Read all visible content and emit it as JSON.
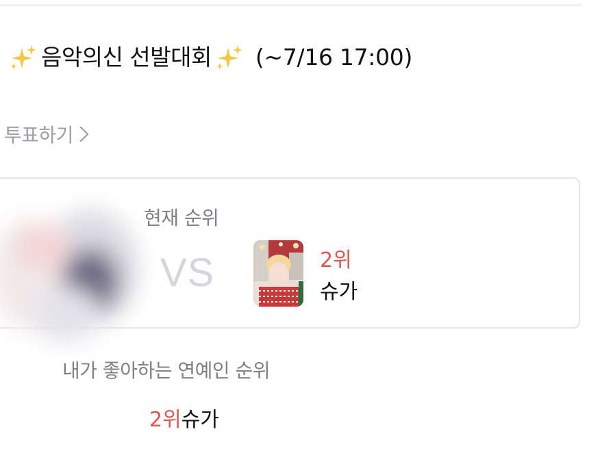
{
  "contest": {
    "title": "음악의신 선발대회",
    "deadline": "(~7/16 17:00)",
    "title_icon": "sparkles-icon",
    "accent_color": "#e0544f"
  },
  "vote_link": {
    "label": "투표하기",
    "icon": "chevron-right-icon"
  },
  "current_ranking": {
    "label": "현재 순위",
    "vs": "VS",
    "candidate": {
      "rank": "2위",
      "name": "슈가"
    }
  },
  "favorite_ranking": {
    "label": "내가 좋아하는 연예인 순위",
    "rank": "2위",
    "name": "슈가"
  }
}
